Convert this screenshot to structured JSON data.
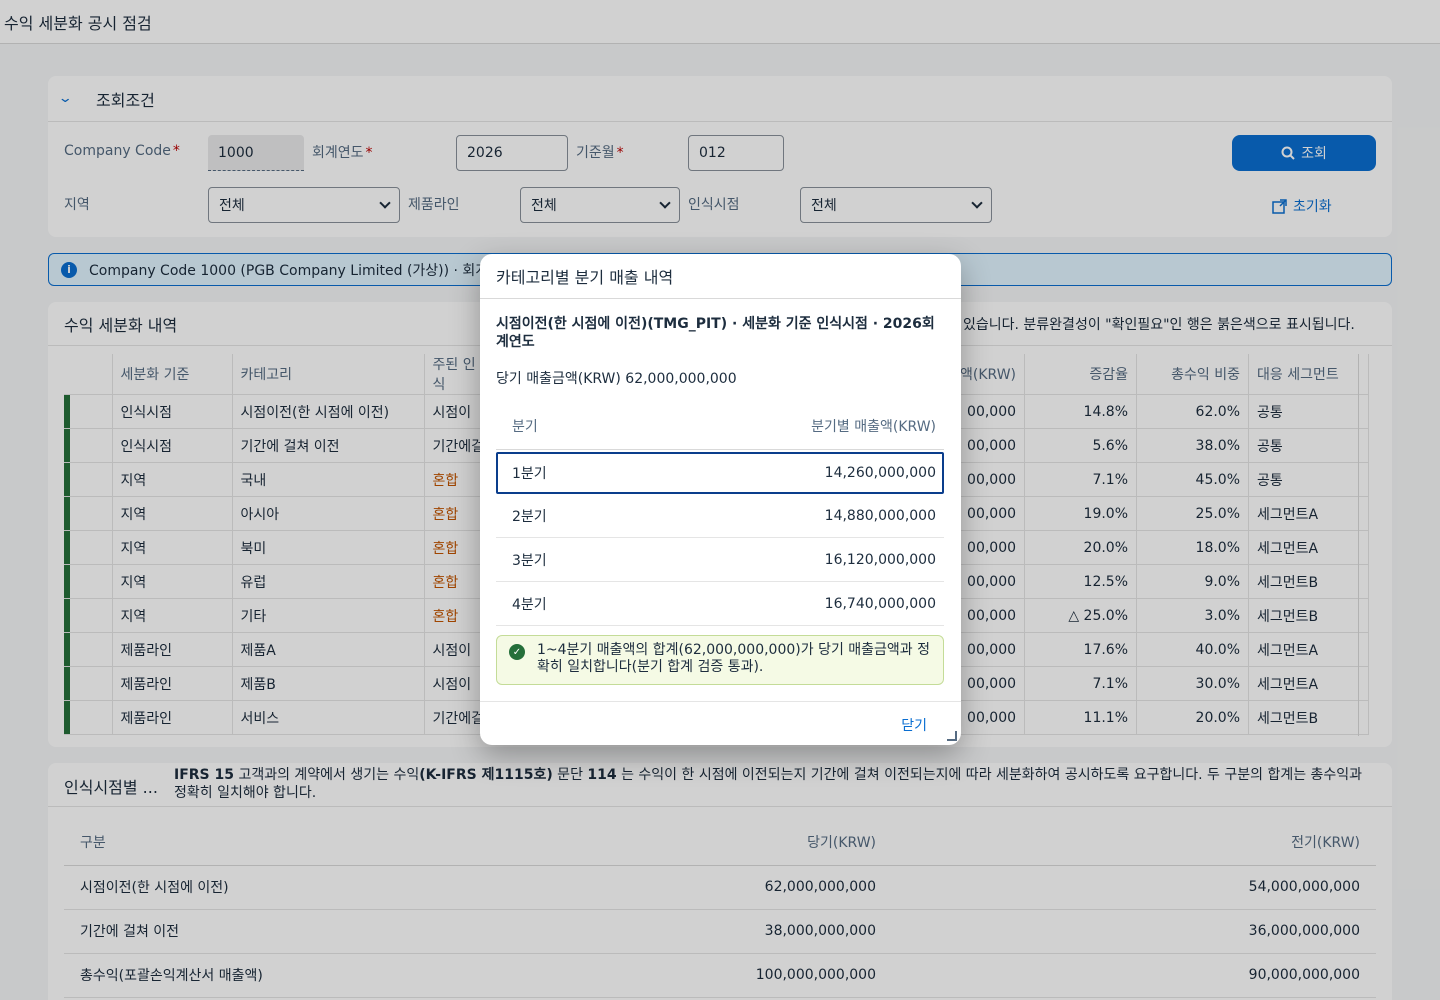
{
  "shell": {
    "title": "수익 세분화 공시 점검"
  },
  "filters": {
    "header": "조회조건",
    "company_code_label": "Company Code",
    "company_code_value": "1000",
    "fiscal_year_label": "회계연도",
    "fiscal_year_value": "2026",
    "period_label": "기준월",
    "period_value": "012",
    "region_label": "지역",
    "region_value": "전체",
    "product_line_label": "제품라인",
    "product_line_value": "전체",
    "timing_label": "인식시점",
    "timing_value": "전체",
    "search_button": "조회",
    "reset_button": "초기화",
    "required_mark": "*"
  },
  "info_strip": {
    "text": "Company Code 1000 (PGB Company Limited (가상)) · 회계연도"
  },
  "detail_table": {
    "title": "수익 세분화 내역",
    "note": "있습니다. 분류완결성이 \"확인필요\"인 행은 붉은색으로 표시됩니다.",
    "columns": [
      "세분화 기준",
      "카테고리",
      "주된 인식",
      "액(KRW)",
      "증감율",
      "총수익 비중",
      "대응 세그먼트"
    ],
    "rows": [
      {
        "basis": "인식시점",
        "category": "시점이전(한 시점에 이전)",
        "timing": "시점이",
        "amount": "00,000",
        "change": "14.8%",
        "share": "62.0%",
        "segment": "공통"
      },
      {
        "basis": "인식시점",
        "category": "기간에 걸쳐 이전",
        "timing": "기간에걸",
        "amount": "00,000",
        "change": "5.6%",
        "share": "38.0%",
        "segment": "공통"
      },
      {
        "basis": "지역",
        "category": "국내",
        "timing": "혼합",
        "amount": "00,000",
        "change": "7.1%",
        "share": "45.0%",
        "segment": "공통"
      },
      {
        "basis": "지역",
        "category": "아시아",
        "timing": "혼합",
        "amount": "00,000",
        "change": "19.0%",
        "share": "25.0%",
        "segment": "세그먼트A"
      },
      {
        "basis": "지역",
        "category": "북미",
        "timing": "혼합",
        "amount": "00,000",
        "change": "20.0%",
        "share": "18.0%",
        "segment": "세그먼트A"
      },
      {
        "basis": "지역",
        "category": "유럽",
        "timing": "혼합",
        "amount": "00,000",
        "change": "12.5%",
        "share": "9.0%",
        "segment": "세그먼트B"
      },
      {
        "basis": "지역",
        "category": "기타",
        "timing": "혼합",
        "amount": "00,000",
        "change": "△ 25.0%",
        "share": "3.0%",
        "segment": "세그먼트B"
      },
      {
        "basis": "제품라인",
        "category": "제품A",
        "timing": "시점이",
        "amount": "00,000",
        "change": "17.6%",
        "share": "40.0%",
        "segment": "세그먼트A"
      },
      {
        "basis": "제품라인",
        "category": "제품B",
        "timing": "시점이",
        "amount": "00,000",
        "change": "7.1%",
        "share": "30.0%",
        "segment": "세그먼트A"
      },
      {
        "basis": "제품라인",
        "category": "서비스",
        "timing": "기간에걸",
        "amount": "00,000",
        "change": "11.1%",
        "share": "20.0%",
        "segment": "세그먼트B"
      }
    ]
  },
  "summary": {
    "title": "인식시점별 ...",
    "text_parts": [
      "IFRS 15",
      " 고객과의 계약에서 생기는 수익",
      "(K-IFRS 제1115호)",
      " 문단 ",
      "114",
      " 는 수익이 한 시점에 이전되는지 기간에 걸쳐 이전되는지에 따라 세분화하여 공시하도록 요구합니다. 두 구분의 합계는 총수익과 정확히 일치해야 합니다."
    ],
    "col_label": "구분",
    "col_current": "당기(KRW)",
    "col_prior": "전기(KRW)",
    "rows": [
      {
        "label": "시점이전(한 시점에 이전)",
        "current": "62,000,000,000",
        "prior": "54,000,000,000"
      },
      {
        "label": "기간에 걸쳐 이전",
        "current": "38,000,000,000",
        "prior": "36,000,000,000"
      },
      {
        "label": "총수익(포괄손익계산서 매출액)",
        "current": "100,000,000,000",
        "prior": "90,000,000,000"
      }
    ]
  },
  "dialog": {
    "title": "카테고리별 분기 매출 내역",
    "subtitle": "시점이전(한 시점에 이전)(TMG_PIT) · 세분화 기준 인식시점 · 2026회계연도",
    "amount_line": "당기 매출금액(KRW) 62,000,000,000",
    "col_quarter": "분기",
    "col_amount": "분기별 매출액(KRW)",
    "rows": [
      {
        "quarter": "1분기",
        "amount": "14,260,000,000"
      },
      {
        "quarter": "2분기",
        "amount": "14,880,000,000"
      },
      {
        "quarter": "3분기",
        "amount": "16,120,000,000"
      },
      {
        "quarter": "4분기",
        "amount": "16,740,000,000"
      }
    ],
    "success_message": "1~4분기 매출액의 합계(62,000,000,000)가 당기 매출금액과 정확히 일치합니다(분기 합계 검증 통과).",
    "close_button": "닫기"
  }
}
